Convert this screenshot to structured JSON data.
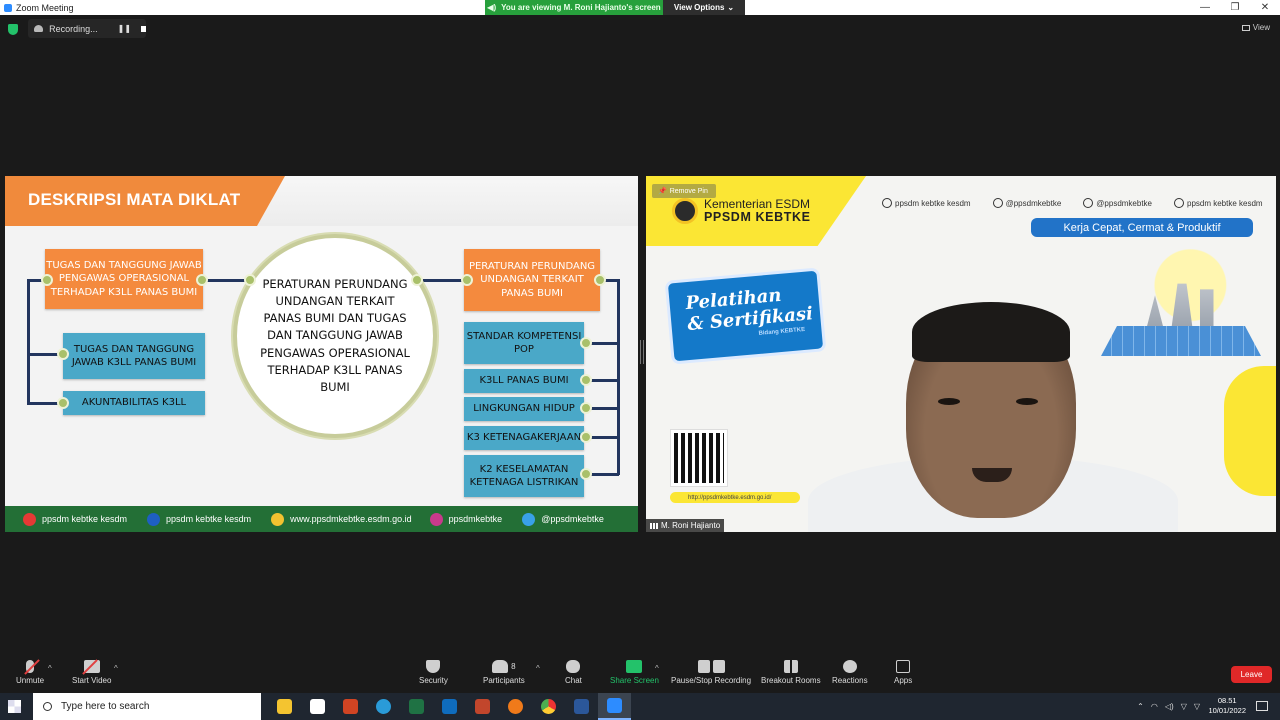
{
  "window": {
    "title": "Zoom Meeting",
    "controls": [
      "—",
      "❐",
      "✕"
    ]
  },
  "banner": {
    "viewing": "You are viewing M. Roni Hajianto's screen",
    "view_options": "View Options"
  },
  "recording": {
    "label": "Recording..."
  },
  "view_label": "View",
  "slide": {
    "title": "DESKRIPSI MATA DIKLAT",
    "left_top": "TUGAS DAN TANGGUNG JAWAB PENGAWAS OPERASIONAL TERHADAP K3LL PANAS BUMI",
    "left_mid": "TUGAS DAN TANGGUNG JAWAB K3LL PANAS BUMI",
    "left_bottom": "AKUNTABILITAS K3LL",
    "center": "PERATURAN PERUNDANG UNDANGAN TERKAIT PANAS BUMI DAN TUGAS DAN TANGGUNG JAWAB PENGAWAS OPERASIONAL TERHADAP K3LL PANAS BUMI",
    "right_top": "PERATURAN PERUNDANG UNDANGAN TERKAIT PANAS BUMI",
    "right_items": [
      "STANDAR KOMPETENSI POP",
      "K3LL PANAS BUMI",
      "LINGKUNGAN HIDUP",
      "K3 KETENAGAKERJAAN",
      "K2 KESELAMATAN KETENAGA LISTRIKAN"
    ],
    "footer": [
      {
        "icon": "youtube-icon",
        "color": "#e53935",
        "text": "ppsdm kebtke kesdm"
      },
      {
        "icon": "facebook-icon",
        "color": "#1e5fc2",
        "text": "ppsdm kebtke kesdm"
      },
      {
        "icon": "globe-icon",
        "color": "#f2c230",
        "text": "www.ppsdmkebtke.esdm.go.id"
      },
      {
        "icon": "instagram-icon",
        "color": "#c83a8c",
        "text": "ppsdmkebtke"
      },
      {
        "icon": "twitter-icon",
        "color": "#39a1e8",
        "text": "@ppsdmkebtke"
      }
    ]
  },
  "video": {
    "remove_pin": "Remove Pin",
    "org_line1": "Kementerian ESDM",
    "org_line2": "PPSDM KEBTKE",
    "socials": [
      "ppsdm kebtke kesdm",
      "@ppsdmkebtke",
      "@ppsdmkebtke",
      "ppsdm kebtke kesdm"
    ],
    "motto": "Kerja Cepat, Cermat & Produktif",
    "pelatihan_line1": "Pelatihan",
    "pelatihan_line2": "& Sertifikasi",
    "bidang": "Bidang KEBTKE",
    "qr_url": "http://ppsdmkebtke.esdm.go.id/",
    "participant_name": "M. Roni Hajianto"
  },
  "toolbar": {
    "unmute": "Unmute",
    "start_video": "Start Video",
    "security": "Security",
    "participants": "Participants",
    "participants_count": "8",
    "chat": "Chat",
    "share_screen": "Share Screen",
    "pause_stop": "Pause/Stop Recording",
    "breakout": "Breakout Rooms",
    "reactions": "Reactions",
    "apps": "Apps",
    "leave": "Leave",
    "accent": "#23c26a"
  },
  "taskbar": {
    "search_placeholder": "Type here to search",
    "time": "08.51",
    "date": "10/01/2022",
    "apps": [
      {
        "name": "file-explorer-icon",
        "color": "#f4c430"
      },
      {
        "name": "store-icon",
        "color": "#ffffff"
      },
      {
        "name": "powerpoint-icon",
        "color": "#d04423"
      },
      {
        "name": "edge-icon",
        "color": "#2a9bd8"
      },
      {
        "name": "excel-icon",
        "color": "#1f7244"
      },
      {
        "name": "outlook-icon",
        "color": "#0f6cbd"
      },
      {
        "name": "media-icon",
        "color": "#c2462c"
      },
      {
        "name": "firefox-icon",
        "color": "#f07a1a"
      },
      {
        "name": "chrome-icon",
        "color": "#4caf50"
      },
      {
        "name": "word-icon",
        "color": "#2b579a"
      },
      {
        "name": "zoom-icon",
        "color": "#2d8cff"
      }
    ]
  }
}
